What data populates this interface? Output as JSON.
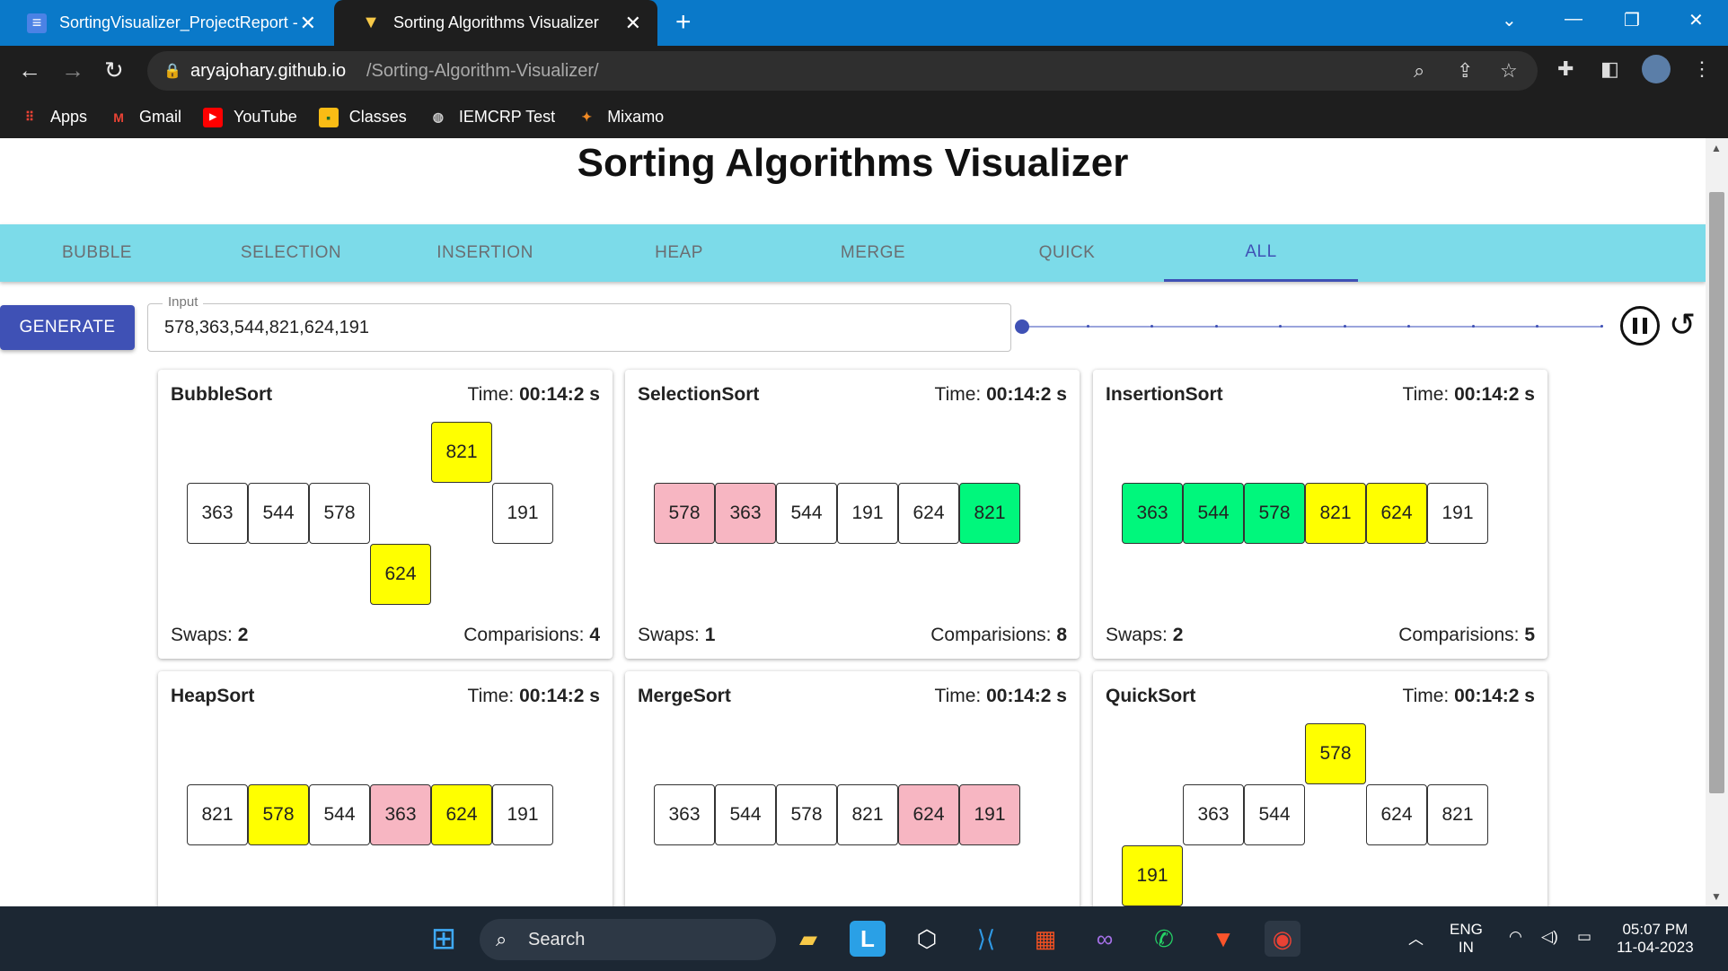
{
  "browser": {
    "tabs": [
      {
        "title": "SortingVisualizer_ProjectReport -",
        "active": false
      },
      {
        "title": "Sorting Algorithms Visualizer",
        "active": true
      }
    ],
    "url_host": "aryajohary.github.io",
    "url_path": "/Sorting-Algorithm-Visualizer/",
    "bookmarks": [
      "Apps",
      "Gmail",
      "YouTube",
      "Classes",
      "IEMCRP Test",
      "Mixamo"
    ]
  },
  "page": {
    "title": "Sorting Algorithms Visualizer",
    "nav_tabs": [
      "BUBBLE",
      "SELECTION",
      "INSERTION",
      "HEAP",
      "MERGE",
      "QUICK",
      "ALL"
    ],
    "active_tab": "ALL",
    "generate_label": "GENERATE",
    "input_label": "Input",
    "input_value": "578,363,544,821,624,191",
    "speed_level": 0
  },
  "labels": {
    "time": "Time:",
    "swaps": "Swaps:",
    "comparisons": "Comparisions:"
  },
  "cards": [
    {
      "name": "BubbleSort",
      "time": "00:14:2 s",
      "swaps": "2",
      "comparisons": "4",
      "cells": [
        {
          "v": "363",
          "state": "default",
          "level": 0
        },
        {
          "v": "544",
          "state": "default",
          "level": 0
        },
        {
          "v": "578",
          "state": "default",
          "level": 0
        },
        {
          "v": "624",
          "state": "yellow",
          "level": -1
        },
        {
          "v": "821",
          "state": "yellow",
          "level": 1
        },
        {
          "v": "191",
          "state": "default",
          "level": 0
        }
      ]
    },
    {
      "name": "SelectionSort",
      "time": "00:14:2 s",
      "swaps": "1",
      "comparisons": "8",
      "cells": [
        {
          "v": "578",
          "state": "pink",
          "level": 0
        },
        {
          "v": "363",
          "state": "pink",
          "level": 0
        },
        {
          "v": "544",
          "state": "default",
          "level": 0
        },
        {
          "v": "191",
          "state": "default",
          "level": 0
        },
        {
          "v": "624",
          "state": "default",
          "level": 0
        },
        {
          "v": "821",
          "state": "green",
          "level": 0
        }
      ]
    },
    {
      "name": "InsertionSort",
      "time": "00:14:2 s",
      "swaps": "2",
      "comparisons": "5",
      "cells": [
        {
          "v": "363",
          "state": "green",
          "level": 0
        },
        {
          "v": "544",
          "state": "green",
          "level": 0
        },
        {
          "v": "578",
          "state": "green",
          "level": 0
        },
        {
          "v": "821",
          "state": "yellow",
          "level": 0
        },
        {
          "v": "624",
          "state": "yellow",
          "level": 0
        },
        {
          "v": "191",
          "state": "default",
          "level": 0
        }
      ]
    },
    {
      "name": "HeapSort",
      "time": "00:14:2 s",
      "swaps": "",
      "comparisons": "",
      "cells": [
        {
          "v": "821",
          "state": "default",
          "level": 0
        },
        {
          "v": "578",
          "state": "yellow",
          "level": 0
        },
        {
          "v": "544",
          "state": "default",
          "level": 0
        },
        {
          "v": "363",
          "state": "pink",
          "level": 0
        },
        {
          "v": "624",
          "state": "yellow",
          "level": 0
        },
        {
          "v": "191",
          "state": "default",
          "level": 0
        }
      ]
    },
    {
      "name": "MergeSort",
      "time": "00:14:2 s",
      "swaps": "",
      "comparisons": "",
      "cells": [
        {
          "v": "363",
          "state": "default",
          "level": 0
        },
        {
          "v": "544",
          "state": "default",
          "level": 0
        },
        {
          "v": "578",
          "state": "default",
          "level": 0
        },
        {
          "v": "821",
          "state": "default",
          "level": 0
        },
        {
          "v": "624",
          "state": "pink",
          "level": 0
        },
        {
          "v": "191",
          "state": "pink",
          "level": 0
        }
      ]
    },
    {
      "name": "QuickSort",
      "time": "00:14:2 s",
      "swaps": "",
      "comparisons": "",
      "cells": [
        {
          "v": "191",
          "state": "yellow",
          "level": -1
        },
        {
          "v": "363",
          "state": "default",
          "level": 0
        },
        {
          "v": "544",
          "state": "default",
          "level": 0
        },
        {
          "v": "578",
          "state": "yellow",
          "level": 1
        },
        {
          "v": "624",
          "state": "default",
          "level": 0
        },
        {
          "v": "821",
          "state": "default",
          "level": 0
        }
      ]
    }
  ],
  "taskbar": {
    "search_label": "Search",
    "lang_top": "ENG",
    "lang_bottom": "IN",
    "time": "05:07 PM",
    "date": "11-04-2023"
  },
  "colors": {
    "accent": "#3f51b5",
    "navbar": "#7cdbe9",
    "yellow": "#ffff00",
    "pink": "#f7b6c2",
    "green": "#00f77c"
  }
}
